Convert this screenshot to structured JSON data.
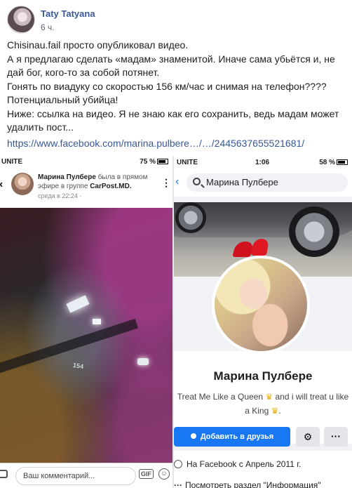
{
  "post": {
    "author": "Taty Tatyana",
    "time": "6 ч.",
    "lines": [
      "Chisinau.fail просто опубликовал видео.",
      "А я предлагаю сделать «мадам» знаменитой. Иначе сама убьётся и, не дай бог, кого-то за собой потянет.",
      "Гонять по виадуку со скоростью 156 км/час и снимая на телефон????",
      "Потенциальный убийца!",
      "Ниже: ссылка на видео. Я не знаю как его сохранить, ведь мадам может удалить пост..."
    ],
    "link": "https://www.facebook.com/marina.pulbere…/…/2445637655521681/"
  },
  "left_shot": {
    "carrier": "UNITE",
    "battery": "75 %",
    "header_name": "Марина Пулбере",
    "header_action": "была в прямом эфире в группе",
    "header_group": "CarPost.MD.",
    "header_when": "среда в 22:24 ·",
    "speed_text": "154",
    "comment_placeholder": "Ваш комментарий...",
    "gif_label": "GIF"
  },
  "right_shot": {
    "carrier": "UNITE",
    "clock": "1:06",
    "battery": "58 %",
    "search_value": "Марина Пулбере",
    "profile_name": "Марина Пулбере",
    "bio_part1": "Treat Me Like a Queen",
    "bio_part2": "and i will treat u like a King",
    "add_friend_label": "Добавить в друзья",
    "info_since": "На Facebook с Апрель 2011 г.",
    "info_more": "Посмотреть раздел \"Информация\""
  }
}
